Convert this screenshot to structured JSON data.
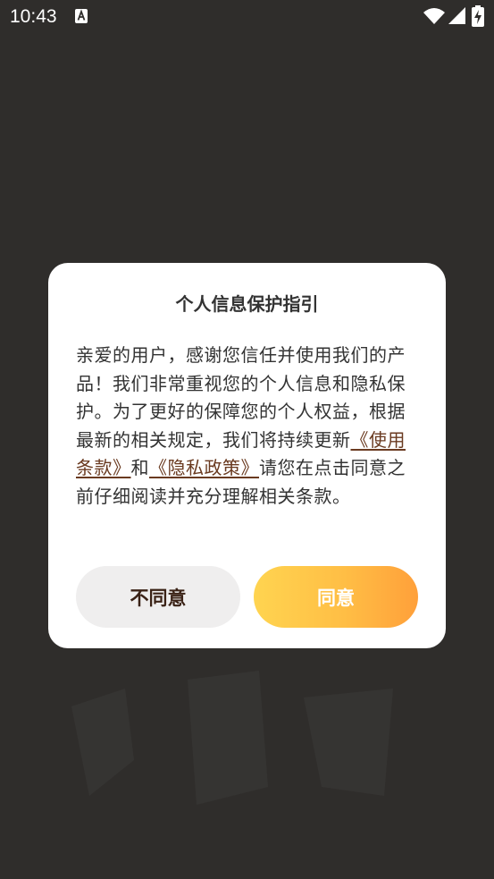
{
  "status_bar": {
    "time": "10:43",
    "icons": [
      "a-notification-icon",
      "wifi-icon",
      "signal-icon",
      "battery-charging-icon"
    ]
  },
  "dialog": {
    "title": "个人信息保护指引",
    "body_intro": "亲爱的用户，感谢您信任并使用我们的产品！我们非常重视您的个人信息和隐私保护。为了更好的保障您的个人权益，根据最新的相关规定，我们将持续更新",
    "terms_link": "《使用条款》",
    "conjunction": "和",
    "privacy_link": "《隐私政策》",
    "body_outro": "请您在点击同意之前仔细阅读并充分理解相关条款。",
    "disagree_label": "不同意",
    "agree_label": "同意"
  },
  "colors": {
    "overlay": "#2f2d2b",
    "dialog_bg": "#ffffff",
    "link": "#6a3a20",
    "disagree_bg": "#efeeee",
    "agree_gradient_start": "#ffd450",
    "agree_gradient_end": "#ffa03a"
  }
}
